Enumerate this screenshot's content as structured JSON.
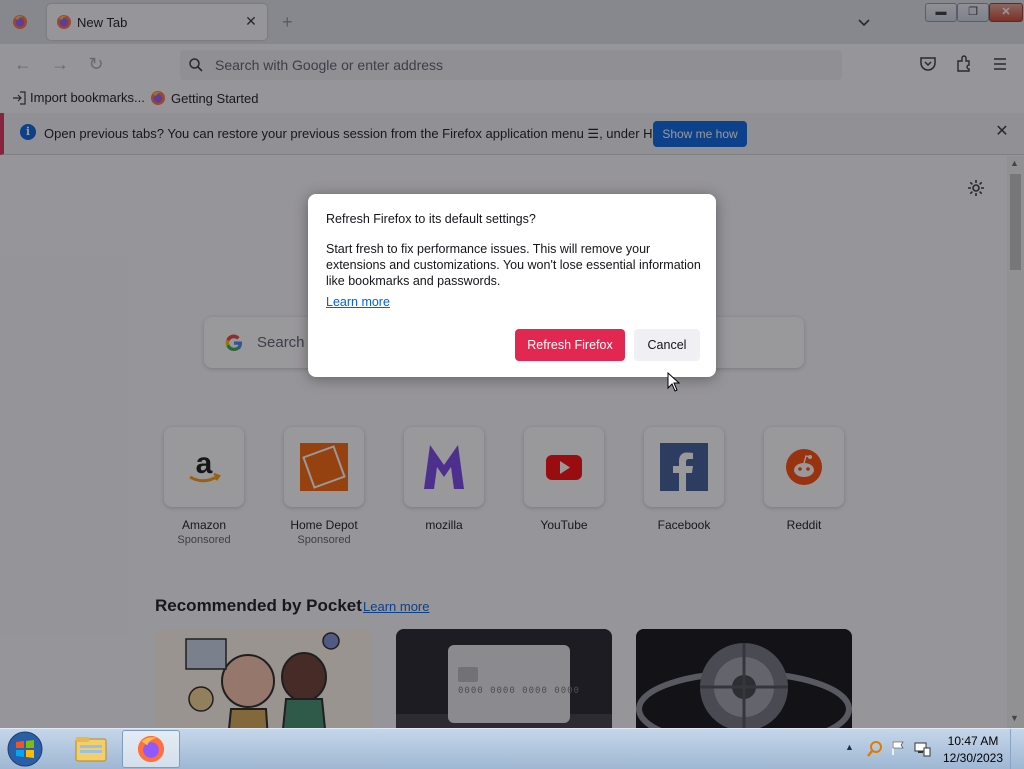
{
  "browser": {
    "tab_title": "New Tab",
    "url_placeholder": "Search with Google or enter address",
    "bookmarks": [
      "Import bookmarks...",
      "Getting Started"
    ]
  },
  "notification": {
    "message": "Open previous tabs? You can restore your previous session from the Firefox application menu ☰, under History.",
    "button_label": "Show me how"
  },
  "newtab": {
    "search_placeholder": "Search w",
    "shortcuts": [
      {
        "label": "Amazon",
        "sub": "Sponsored",
        "icon": "amazon-logo"
      },
      {
        "label": "Home Depot",
        "sub": "Sponsored",
        "icon": "home-depot-logo"
      },
      {
        "label": "mozilla",
        "sub": "",
        "icon": "mozilla-logo"
      },
      {
        "label": "YouTube",
        "sub": "",
        "icon": "youtube-logo"
      },
      {
        "label": "Facebook",
        "sub": "",
        "icon": "facebook-logo"
      },
      {
        "label": "Reddit",
        "sub": "",
        "icon": "reddit-logo"
      }
    ],
    "pocket_title": "Recommended by Pocket",
    "pocket_learn_more": "Learn more",
    "card_number_text": "0000 0000 0000 0000"
  },
  "dialog": {
    "title": "Refresh Firefox to its default settings?",
    "body": "Start fresh to fix performance issues. This will remove your extensions and customizations. You won't lose essential information like bookmarks and passwords.",
    "learn_more": "Learn more",
    "primary_button": "Refresh Firefox",
    "secondary_button": "Cancel"
  },
  "taskbar": {
    "time": "10:47 AM",
    "date": "12/30/2023"
  },
  "colors": {
    "accent_red": "#e22850",
    "link_blue": "#0060df",
    "button_blue": "#0061e0"
  }
}
